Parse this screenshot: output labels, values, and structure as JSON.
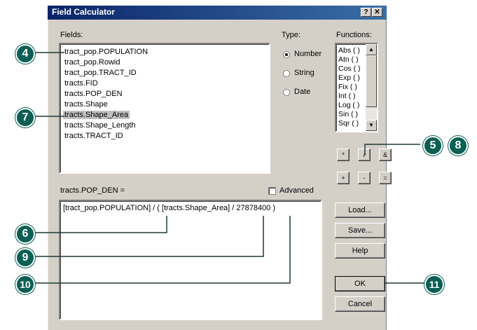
{
  "window": {
    "title": "Field Calculator",
    "help_glyph": "?",
    "close_glyph": "✕"
  },
  "fields": {
    "label": "Fields:",
    "items": [
      "tract_pop.POPULATION",
      "tract_pop.Rowid",
      "tract_pop.TRACT_ID",
      "tracts.FID",
      "tracts.POP_DEN",
      "tracts.Shape",
      "tracts.Shape_Area",
      "tracts.Shape_Length",
      "tracts.TRACT_ID"
    ],
    "selected_index": 6
  },
  "type": {
    "label": "Type:",
    "options": [
      "Number",
      "String",
      "Date"
    ],
    "selected": "Number"
  },
  "functions": {
    "label": "Functions:",
    "items": [
      "Abs ( )",
      "Atn ( )",
      "Cos ( )",
      "Exp ( )",
      "Fix ( )",
      "Int ( )",
      "Log ( )",
      "Sin ( )",
      "Sqr ( )"
    ]
  },
  "operators": [
    "*",
    "/",
    "&",
    "+",
    "-",
    "="
  ],
  "expression": {
    "label": "tracts.POP_DEN =",
    "value": "[tract_pop.POPULATION] / ( [tracts.Shape_Area] / 27878400 )",
    "advanced_label": "Advanced",
    "advanced_checked": false
  },
  "buttons": {
    "load": "Load...",
    "save": "Save...",
    "help": "Help",
    "ok": "OK",
    "cancel": "Cancel"
  },
  "callouts": [
    "4",
    "7",
    "5",
    "8",
    "6",
    "9",
    "10",
    "11"
  ],
  "colors": {
    "callout": "#0b5f54",
    "titlebar": "#0a246a",
    "face": "#d4d0c8"
  }
}
